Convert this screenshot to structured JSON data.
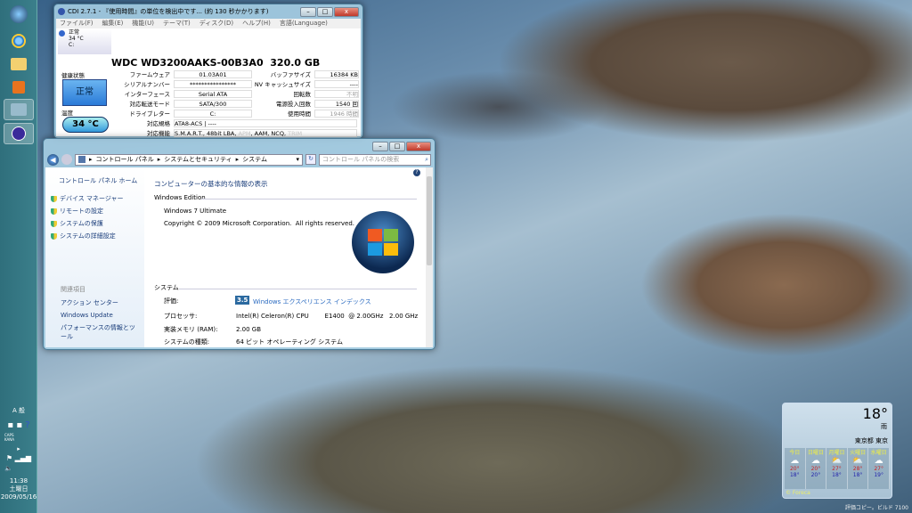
{
  "taskbar": {
    "clock": {
      "time": "11:38",
      "day": "土曜日",
      "date": "2009/05/16"
    },
    "ime": "A 般",
    "caps": "CAPS",
    "kana": "KANA"
  },
  "cdi": {
    "title": "CDI 2.7.1 - 『使用時間』の単位を検出中です... (約 130 秒かかります)",
    "menu": [
      "ファイル(F)",
      "編集(E)",
      "機能(U)",
      "テーマ(T)",
      "ディスク(D)",
      "ヘルプ(H)",
      "言語(Language)"
    ],
    "mini": {
      "status": "正常",
      "temp": "34 °C",
      "drive": "C:"
    },
    "model": "WDC WD3200AAKS-00B3A0  320.0 GB",
    "health_label": "健康状態",
    "health_value": "正常",
    "temp_label": "温度",
    "temp_value": "34 °C",
    "left": [
      {
        "label": "ファームウェア",
        "value": "01.03A01"
      },
      {
        "label": "シリアルナンバー",
        "value": "****************"
      },
      {
        "label": "インターフェース",
        "value": "Serial ATA"
      },
      {
        "label": "対応転送モード",
        "value": "SATA/300"
      },
      {
        "label": "ドライブレター",
        "value": "C:"
      }
    ],
    "right": [
      {
        "label": "バッファサイズ",
        "value": "16384 KB"
      },
      {
        "label": "NV キャッシュサイズ",
        "value": "----"
      },
      {
        "label": "回転数",
        "value": "不明"
      },
      {
        "label": "電源投入回数",
        "value": "1540 回"
      },
      {
        "label": "使用時間",
        "value": "1946 時間"
      }
    ],
    "standard_label": "対応規格",
    "standard_value": "ATA8-ACS | ----",
    "features_label": "対応機能",
    "features": [
      "S.M.A.R.T., 48bit LBA, ",
      "APM",
      ", AAM, NCQ, ",
      "TRIM"
    ]
  },
  "cp": {
    "breadcrumb": [
      "コントロール パネル",
      "システムとセキュリティ",
      "システム"
    ],
    "search_placeholder": "コントロール パネルの検索",
    "side_home": "コントロール パネル ホーム",
    "side_links": [
      "デバイス マネージャー",
      "リモートの設定",
      "システムの保護",
      "システムの詳細設定"
    ],
    "related_title": "関連項目",
    "related": [
      "アクション センター",
      "Windows Update",
      "パフォーマンスの情報とツール"
    ],
    "heading": "コンピューターの基本的な情報の表示",
    "edition_title": "Windows Edition",
    "edition": "Windows 7 Ultimate",
    "copyright": "Copyright © 2009 Microsoft Corporation.  All rights reserved.",
    "system_title": "システム",
    "rating_label": "評価:",
    "rating_score": "3.5",
    "rating_link": "Windows エクスペリエンス インデックス",
    "rows": [
      {
        "label": "プロセッサ:",
        "value": "Intel(R) Celeron(R) CPU        E1400  @ 2.00GHz   2.00 GHz"
      },
      {
        "label": "実装メモリ (RAM):",
        "value": "2.00 GB"
      },
      {
        "label": "システムの種類:",
        "value": "64 ビット オペレーティング システム"
      }
    ]
  },
  "weather": {
    "temp": "18°",
    "condition": "雨",
    "location": "東京都 東京",
    "credit": "© Foreca",
    "days": [
      {
        "day": "今日",
        "high": "20°",
        "low": "18°"
      },
      {
        "day": "日曜日",
        "high": "20°",
        "low": "20°"
      },
      {
        "day": "月曜日",
        "high": "27°",
        "low": "18°"
      },
      {
        "day": "火曜日",
        "high": "28°",
        "low": "18°"
      },
      {
        "day": "水曜日",
        "high": "27°",
        "low": "19°"
      }
    ]
  },
  "watermark": "評価コピー。ビルド 7100"
}
